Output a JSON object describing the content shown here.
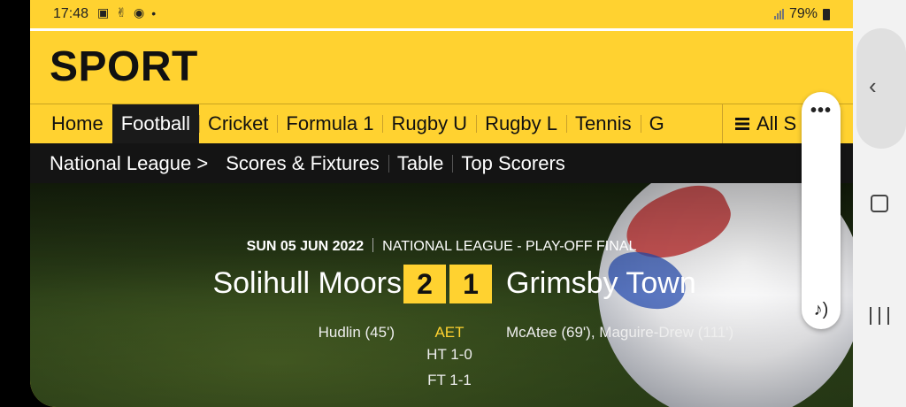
{
  "status_bar": {
    "time": "17:48",
    "battery": "79%",
    "icons": [
      "image-icon",
      "hands-icon",
      "chrome-icon",
      "dot-icon"
    ]
  },
  "header": {
    "brand": "SPORT"
  },
  "nav": {
    "items": [
      {
        "label": "Home",
        "active": false
      },
      {
        "label": "Football",
        "active": true
      },
      {
        "label": "Cricket",
        "active": false
      },
      {
        "label": "Formula 1",
        "active": false
      },
      {
        "label": "Rugby U",
        "active": false
      },
      {
        "label": "Rugby L",
        "active": false
      },
      {
        "label": "Tennis",
        "active": false
      },
      {
        "label": "G",
        "active": false
      }
    ],
    "all_sport": "All S"
  },
  "subnav": {
    "section": "National League >",
    "items": [
      "Scores & Fixtures",
      "Table",
      "Top Scorers"
    ]
  },
  "match": {
    "date": "SUN 05 JUN 2022",
    "competition": "NATIONAL LEAGUE - PLAY-OFF FINAL",
    "home_team": "Solihull Moors",
    "away_team": "Grimsby Town",
    "home_score": "2",
    "away_score": "1",
    "home_scorers": "Hudlin (45')",
    "away_scorers": "McAtee (69'), Maguire-Drew (111')",
    "status": "AET",
    "half_time": "HT 1-0",
    "full_time": "FT 1-1"
  },
  "colors": {
    "brand_yellow": "#ffd230",
    "dark": "#141414"
  }
}
